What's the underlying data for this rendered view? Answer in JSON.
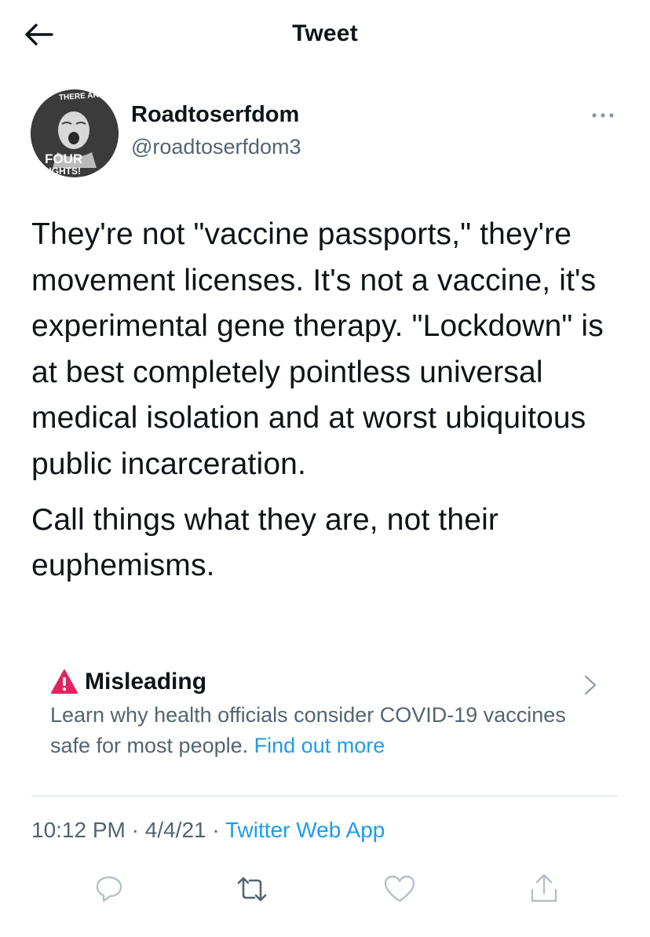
{
  "header": {
    "title": "Tweet",
    "back_icon": "back-arrow-icon"
  },
  "author": {
    "display_name": "Roadtoserfdom",
    "handle": "@roadtoserfdom3",
    "avatar": {
      "text_top": "THERE ARE",
      "text_main": "FOUR",
      "text_bottom": "LIGHTS!"
    },
    "more_icon": "more-dots-icon"
  },
  "tweet": {
    "paragraphs": [
      "They're not \"vaccine passports,\" they're movement licenses. It's not a vaccine, it's experimental gene therapy. \"Lockdown\" is at best completely pointless universal medical isolation and at worst ubiquitous public incarceration.",
      "Call things what they are, not their euphemisms."
    ]
  },
  "notice": {
    "icon": "warning-icon",
    "title": "Misleading",
    "text": "Learn why health officials consider COVID-19 vaccines safe for most people.",
    "link": "Find out more",
    "chevron_icon": "chevron-right-icon"
  },
  "meta": {
    "time": "10:12 PM",
    "date": "4/4/21",
    "source": "Twitter Web App",
    "separator": "·"
  },
  "actions": [
    "reply-icon",
    "retweet-icon",
    "like-icon",
    "share-icon"
  ],
  "colors": {
    "text": "#0f1419",
    "secondary": "#536471",
    "link": "#1d9bf0",
    "warning": "#e0245e",
    "icon_gray": "#8b98a5",
    "divider": "#cfd9de"
  }
}
